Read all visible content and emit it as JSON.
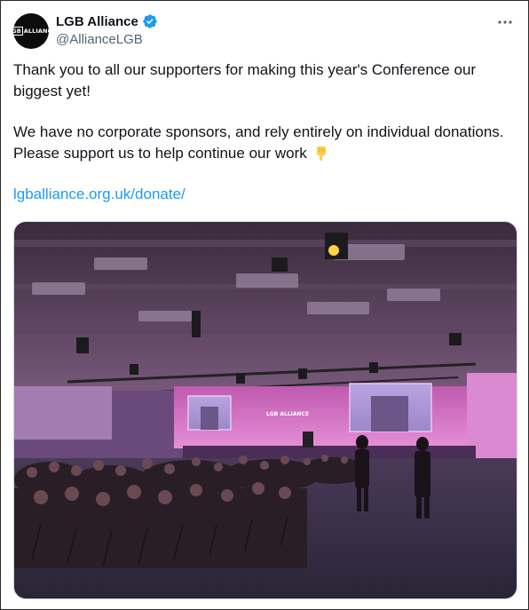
{
  "account": {
    "name": "LGB Alliance",
    "handle": "@AllianceLGB",
    "avatar_text_box": "LGB",
    "avatar_text": "ALLIANCE"
  },
  "icons": {
    "verified": "verified-badge-icon",
    "more": "more-options-icon",
    "emoji": "backhand-index-pointing-down-emoji"
  },
  "tweet": {
    "paragraph_1": "Thank you to all our supporters for making this year's Conference our biggest yet!",
    "paragraph_2": "We have no corporate sponsors, and rely entirely on individual donations. Please support us to help continue our work",
    "link": "lgballiance.org.uk/donate/"
  },
  "photo": {
    "stage_sign": "LGB ALLIANCE"
  },
  "colors": {
    "verified_blue": "#1d9bf0",
    "link_blue": "#1d9bf0",
    "stage_pink": "#e07ad0"
  }
}
